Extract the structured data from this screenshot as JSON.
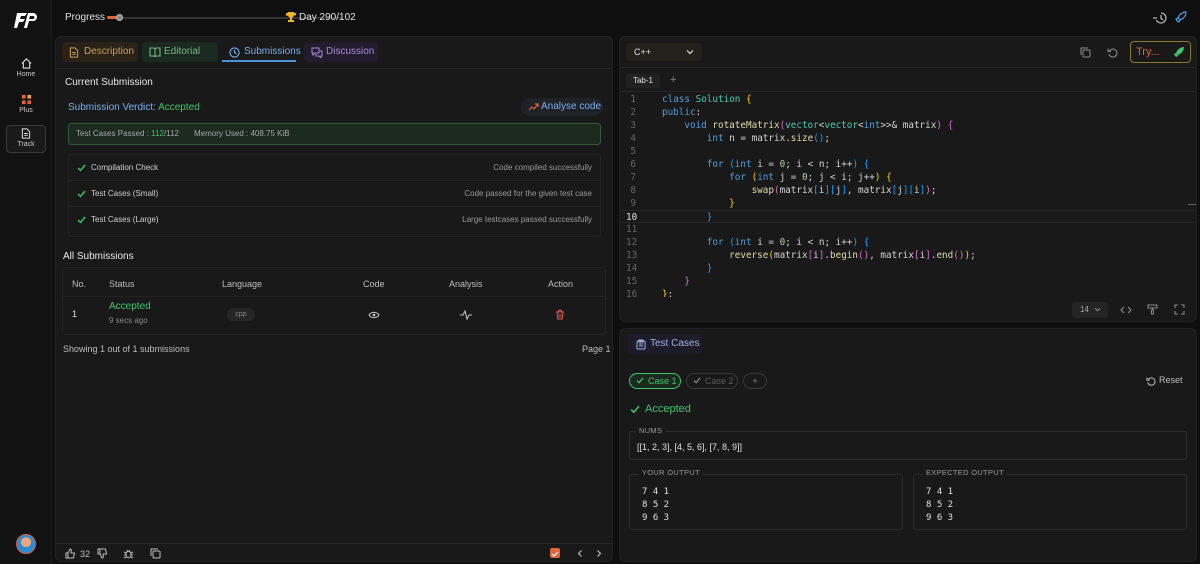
{
  "rail": {
    "items": [
      {
        "label": "Home"
      },
      {
        "label": "Plus"
      },
      {
        "label": "Track"
      }
    ]
  },
  "topbar": {
    "progress_label": "Progress",
    "progress_fraction": 0.05,
    "day_label": "Day 290/102"
  },
  "left": {
    "tabs": [
      {
        "label": "Description"
      },
      {
        "label": "Editorial"
      },
      {
        "label": "Submissions"
      },
      {
        "label": "Discussion"
      }
    ],
    "current_submission_title": "Current Submission",
    "verdict_label": "Submission Verdict:",
    "verdict_value": "Accepted",
    "analyse_label": "Analyse code",
    "tests_passed_label": "Test Cases Passed :",
    "tests_passed_count": "112",
    "tests_total": "/112",
    "memory_label": "Memory Used : 408.75 KiB",
    "checks": [
      {
        "name": "Compilation Check",
        "desc": "Code compiled successfully"
      },
      {
        "name": "Test Cases (Small)",
        "desc": "Code passed for the given test case"
      },
      {
        "name": "Test Cases (Large)",
        "desc": "Large testcases passed successfully"
      }
    ],
    "all_submissions_title": "All Submissions",
    "columns": [
      "No.",
      "Status",
      "Language",
      "Code",
      "Analysis",
      "Action"
    ],
    "rows": [
      {
        "no": "1",
        "status": "Accepted",
        "time": "9 secs ago",
        "language": "cpp"
      }
    ],
    "showing": "Showing 1 out of 1 submissions",
    "page": "Page 1",
    "likes": "32"
  },
  "editor": {
    "language": "C++",
    "try_label": "Try...",
    "tab_label": "Tab-1",
    "font_size": "14",
    "current_line": 10,
    "lines": [
      "class Solution {",
      "public:",
      "    void rotateMatrix(vector<vector<int>>& matrix) {",
      "        int n = matrix.size();",
      "",
      "        for (int i = 0; i < n; i++) {",
      "            for (int j = 0; j < i; j++) {",
      "                swap(matrix[i][j], matrix[j][i]);",
      "            }",
      "        }",
      "",
      "        for (int i = 0; i < n; i++) {",
      "            reverse(matrix[i].begin(), matrix[i].end());",
      "        }",
      "    }",
      "};"
    ]
  },
  "tests": {
    "tab_label": "Test Cases",
    "cases": [
      {
        "label": "Case 1"
      },
      {
        "label": "Case 2"
      }
    ],
    "add_label": "+",
    "reset_label": "Reset",
    "verdict": "Accepted",
    "input_label": "NUMS",
    "input_value": "[[1, 2, 3], [4, 5, 6], [7, 8, 9]]",
    "your_output_label": "YOUR OUTPUT",
    "your_output": [
      "7 4 1",
      "8 5 2",
      "9 6 3"
    ],
    "expected_output_label": "EXPECTED OUTPUT",
    "expected_output": [
      "7 4 1",
      "8 5 2",
      "9 6 3"
    ]
  },
  "colors": {
    "accent_orange": "#e2623a",
    "accepted_green": "#3ec46d",
    "link_blue": "#7ab0ef"
  }
}
